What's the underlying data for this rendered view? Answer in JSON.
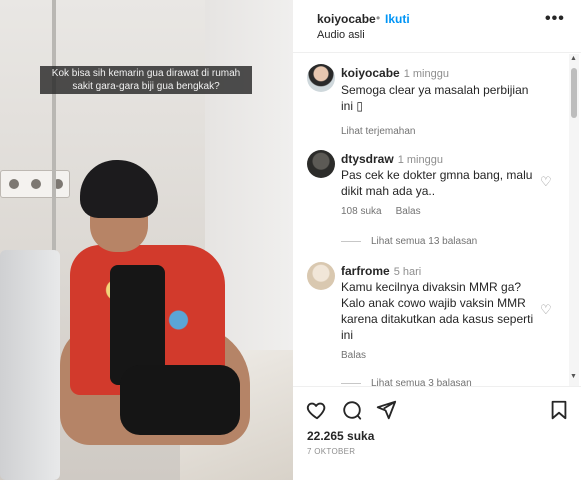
{
  "post": {
    "caption_overlay": "Kok bisa sih kemarin gua dirawat di rumah sakit gara-gara biji gua bengkak?"
  },
  "header": {
    "username": "koiyocabe",
    "separator": "•",
    "follow_label": "Ikuti",
    "audio_label": "Audio asli",
    "more_icon": "more-horizontal-icon"
  },
  "comments": [
    {
      "username": "koiyocabe",
      "time": "1 minggu",
      "text": "Semoga clear ya masalah perbijian ini",
      "text_tail": "▯",
      "meta_translate": "Lihat terjemahan"
    },
    {
      "username": "dtysdraw",
      "time": "1 minggu",
      "text": "Pas cek ke dokter gmna bang, malu dikit mah ada ya..",
      "likes": "108 suka",
      "reply_label": "Balas",
      "view_replies": "Lihat semua 13 balasan"
    },
    {
      "username": "farfrome",
      "time": "5 hari",
      "text": "Kamu kecilnya divaksin MMR ga? Kalo anak cowo wajib vaksin MMR karena ditakutkan ada kasus seperti ini",
      "reply_label": "Balas",
      "view_replies": "Lihat semua 3 balasan"
    }
  ],
  "actions": {
    "like_icon": "heart-icon",
    "comment_icon": "comment-icon",
    "share_icon": "send-icon",
    "save_icon": "bookmark-icon",
    "likes_count": "22.265 suka",
    "date": "7 OKTOBER"
  },
  "colors": {
    "accent": "#0095f6",
    "text": "#262626",
    "muted": "#8e8e8e"
  }
}
